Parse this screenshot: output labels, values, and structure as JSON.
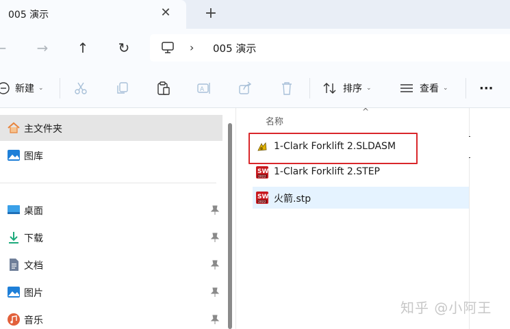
{
  "tab": {
    "title": "005 演示",
    "close_glyph": "✕",
    "new_tab_glyph": "+"
  },
  "nav": {
    "back_glyph": "←",
    "forward_glyph": "→",
    "up_glyph": "↑",
    "refresh_glyph": "↻",
    "breadcrumb_sep": "›",
    "breadcrumb": "005 演示"
  },
  "toolbar": {
    "new_label": "新建",
    "sort_label": "排序",
    "view_label": "查看",
    "more_label": "···",
    "chevron": "⌄"
  },
  "sidebar": {
    "items": [
      {
        "label": "主文件夹",
        "icon": "home-icon"
      },
      {
        "label": "图库",
        "icon": "gallery-icon"
      },
      {
        "label": "桌面",
        "icon": "desktop-icon"
      },
      {
        "label": "下载",
        "icon": "download-icon"
      },
      {
        "label": "文档",
        "icon": "document-icon"
      },
      {
        "label": "图片",
        "icon": "pictures-icon"
      },
      {
        "label": "音乐",
        "icon": "music-icon"
      }
    ]
  },
  "filelist": {
    "column_name": "名称",
    "sort_caret": "^",
    "files": [
      {
        "name": "1-Clark Forklift 2.SLDASM",
        "icon": "solidworks-assembly-icon"
      },
      {
        "name": "1-Clark Forklift 2.STEP",
        "icon": "solidworks-2022-icon"
      },
      {
        "name": "火箭.stp",
        "icon": "solidworks-2022-icon"
      }
    ]
  },
  "watermark": "知乎 @小阿王",
  "colors": {
    "accent": "#0067c0",
    "highlight": "#d9262a",
    "hover": "#e5f3ff",
    "selected": "#e5e5e5"
  }
}
